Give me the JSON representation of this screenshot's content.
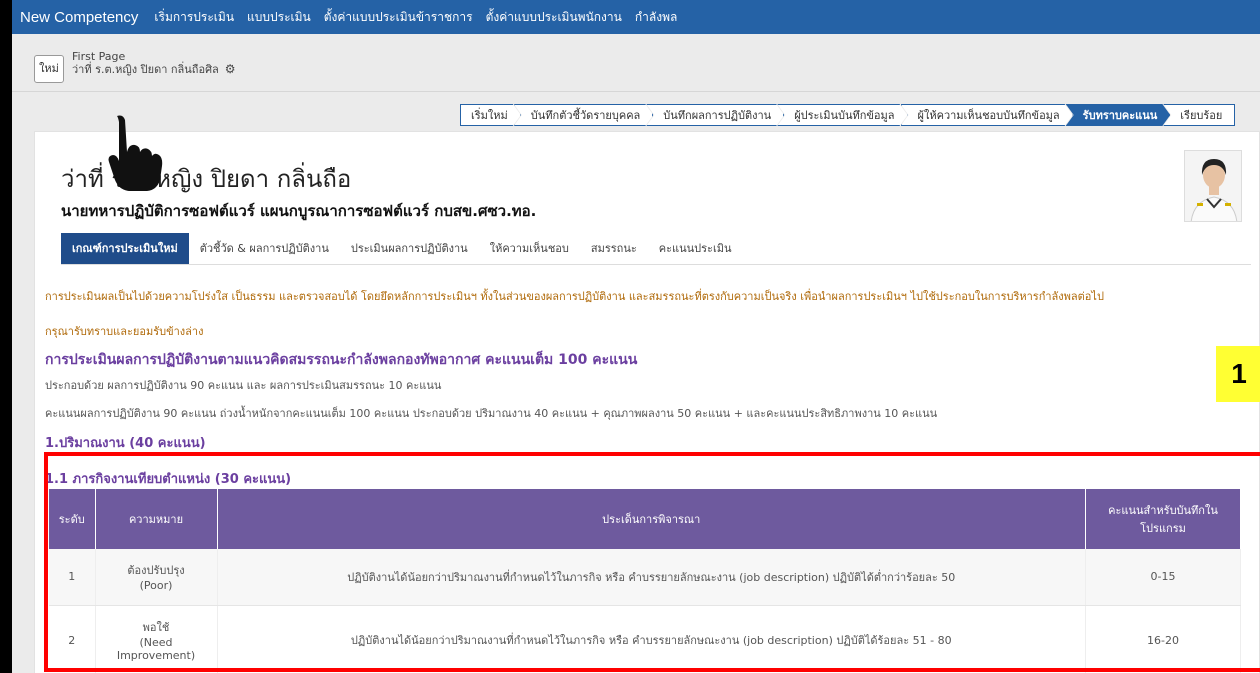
{
  "topnav": {
    "brand": "New Competency",
    "items": [
      "เริ่มการประเมิน",
      "แบบประเมิน",
      "ตั้งค่าแบบประเมินข้าราชการ",
      "ตั้งค่าแบบประเมินพนักงาน",
      "กำลังพล"
    ]
  },
  "subbar": {
    "new_button": "ใหม่",
    "breadcrumb_title": "First Page",
    "breadcrumb_user": "ว่าที่ ร.ต.หญิง ปิยดา กลิ่นถือศิล"
  },
  "steps": [
    "เริ่มใหม่",
    "บันทึกตัวชี้วัดรายบุคคล",
    "บันทึกผลการปฏิบัติงาน",
    "ผู้ประเมินบันทึกข้อมูล",
    "ผู้ให้ความเห็นชอบบันทึกข้อมูล",
    "รับทราบคะแนน",
    "เรียบร้อย"
  ],
  "profile": {
    "name": "ว่าที่ ร.ต.หญิง ปิยดา กลิ่นถือ",
    "position": "นายทหารปฏิบัติการซอฟต์แวร์ แผนกบูรณาการซอฟต์แวร์ กบสข.ศซว.ทอ."
  },
  "tabs": [
    "เกณฑ์การประเมินใหม่",
    "ตัวชี้วัด & ผลการปฏิบัติงาน",
    "ประเมินผลการปฏิบัติงาน",
    "ให้ความเห็นชอบ",
    "สมรรถนะ",
    "คะแนนประเมิน"
  ],
  "content": {
    "intro_1": "การประเมินผลเป็นไปด้วยความโปร่งใส เป็นธรรม และตรวจสอบได้ โดยยึดหลักการประเมินฯ ทั้งในส่วนของผลการปฏิบัติงาน และสมรรถนะที่ตรงกับความเป็นจริง เพื่อนำผลการประเมินฯ ไปใช้ประกอบในการบริหารกำลังพลต่อไป",
    "intro_2": "กรุณารับทราบและยอมรับข้างล่าง",
    "section_title": "การประเมินผลการปฏิบัติงานตามแนวคิดสมรรถนะกำลังพลกองทัพอากาศ คะแนนเต็ม 100 คะแนน",
    "section_sub": "ประกอบด้วย ผลการปฏิบัติงาน 90 คะแนน และ ผลการประเมินสมรรถนะ 10 คะแนน",
    "section_desc": "คะแนนผลการปฏิบัติงาน 90 คะแนน ถ่วงน้ำหนักจากคะแนนเต็ม 100 คะแนน ประกอบด้วย ปริมาณงาน 40 คะแนน + คุณภาพผลงาน 50 คะแนน + และคะแนนประสิทธิภาพงาน 10 คะแนน",
    "heading_1": "1.ปริมาณงาน (40 คะแนน)",
    "heading_2": "1.1 ภารกิจงานเทียบตำแหน่ง (30 คะแนน)",
    "badge": "1"
  },
  "table": {
    "headers": [
      "ระดับ",
      "ความหมาย",
      "ประเด็นการพิจารณา",
      "คะแนนสำหรับบันทึกในโปรแกรม"
    ],
    "rows": [
      {
        "level": "1",
        "meaning_th": "ต้องปรับปรุง",
        "meaning_en": "(Poor)",
        "criteria": "ปฏิบัติงานได้น้อยกว่าปริมาณงานที่กำหนดไว้ในภารกิจ หรือ คำบรรยายลักษณะงาน (job description) ปฏิบัติได้ต่ำกว่าร้อยละ 50",
        "score": "0-15"
      },
      {
        "level": "2",
        "meaning_th": "พอใช้",
        "meaning_en": "(Need Improvement)",
        "criteria": "ปฏิบัติงานได้น้อยกว่าปริมาณงานที่กำหนดไว้ในภารกิจ หรือ คำบรรยายลักษณะงาน (job description) ปฏิบัติได้ร้อยละ 51 - 80",
        "score": "16-20"
      }
    ]
  },
  "colors": {
    "nav": "#2562a6",
    "table_header": "#6e5a9e",
    "heading": "#6b3fa0",
    "intro_text": "#b06a0a",
    "highlight_box": "#ff0000",
    "badge": "#ffff33"
  }
}
